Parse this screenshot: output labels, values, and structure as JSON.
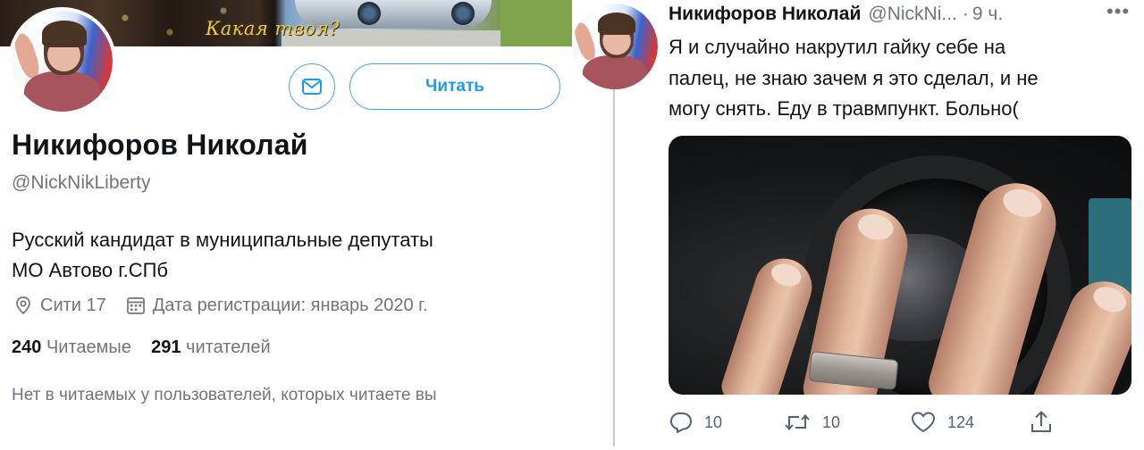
{
  "profile": {
    "banner_caption": "Какая твоя?",
    "follow_label": "Читать",
    "name": "Никифоров Николай",
    "handle": "@NickNikLiberty",
    "bio_line1": "Русский кандидат в муниципальные депутаты",
    "bio_line2": "МО Автово г.СПб",
    "location": "Сити 17",
    "joined": "Дата регистрации: январь 2020 г.",
    "following_count": "240",
    "following_label": "Читаемые",
    "followers_count": "291",
    "followers_label": "читателей",
    "followed_by_note": "Нет в читаемых у пользователей, которых читаете вы",
    "icons": {
      "message": "envelope-icon",
      "location": "map-pin-icon",
      "joined": "calendar-icon"
    },
    "accent_color": "#1d9bf0"
  },
  "tweet": {
    "author_name": "Никифоров Николай",
    "author_handle": "@NickNi...",
    "separator": "·",
    "time": "9 ч.",
    "more": "•••",
    "text_line1": "Я и случайно накрутил гайку себе на",
    "text_line2": "палец, не знаю зачем я это сделал, и не",
    "text_line3": "могу снять. Еду в травмпункт. Больно(",
    "replies": "10",
    "retweets": "10",
    "likes": "124",
    "icons": {
      "reply": "reply-icon",
      "retweet": "retweet-icon",
      "like": "heart-icon",
      "share": "share-icon"
    }
  }
}
